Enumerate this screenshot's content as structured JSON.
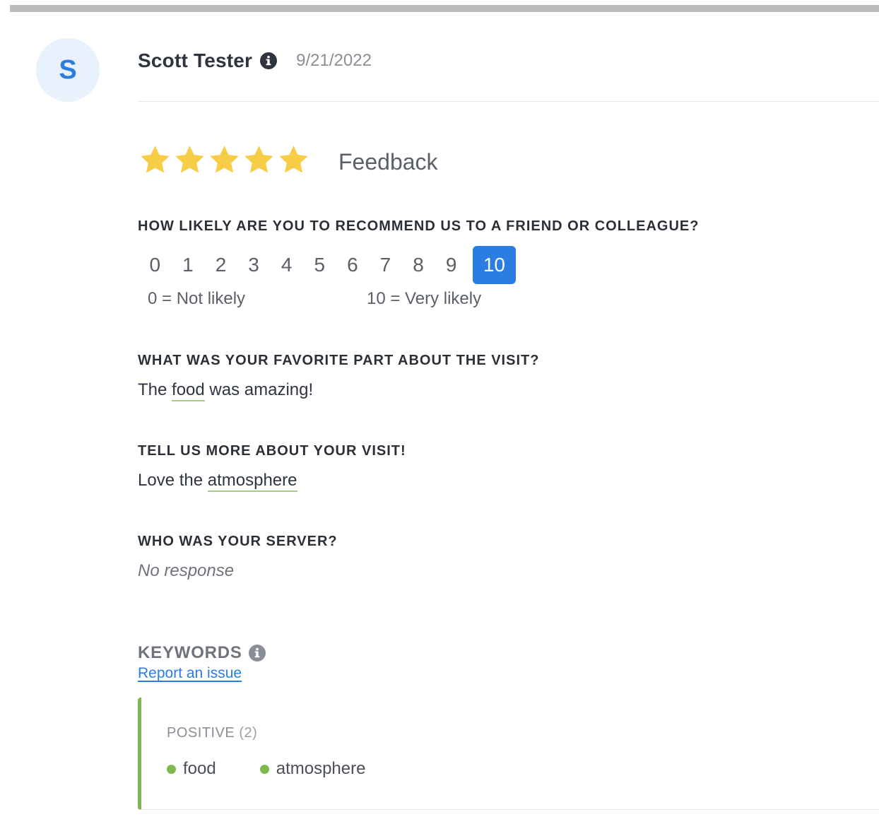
{
  "review": {
    "avatar_initial": "S",
    "reviewer_name": "Scott Tester",
    "date": "9/21/2022",
    "rating": 5,
    "rating_max": 5,
    "source_label": "Feedback"
  },
  "nps": {
    "question": "HOW LIKELY ARE YOU TO RECOMMEND US TO A FRIEND OR COLLEAGUE?",
    "scale": [
      "0",
      "1",
      "2",
      "3",
      "4",
      "5",
      "6",
      "7",
      "8",
      "9",
      "10"
    ],
    "selected": "10",
    "low_label": "0 = Not likely",
    "high_label": "10 = Very likely"
  },
  "q_favorite": {
    "question": "WHAT WAS YOUR FAVORITE PART ABOUT THE VISIT?",
    "answer_before": "The ",
    "answer_keyword": "food",
    "answer_after": " was amazing!"
  },
  "q_more": {
    "question": "TELL US MORE ABOUT YOUR VISIT!",
    "answer_before": "Love the ",
    "answer_keyword": "atmosphere"
  },
  "q_server": {
    "question": "WHO WAS YOUR SERVER?",
    "answer": "No response"
  },
  "keywords": {
    "title": "KEYWORDS",
    "report_link": "Report an issue",
    "positive_label": "POSITIVE",
    "positive_count": "(2)",
    "positive_items": [
      "food",
      "atmosphere"
    ],
    "positive_color": "#7fb84f"
  },
  "colors": {
    "accent": "#2b7de1",
    "star": "#f7cd48",
    "positive": "#7fb84f"
  }
}
